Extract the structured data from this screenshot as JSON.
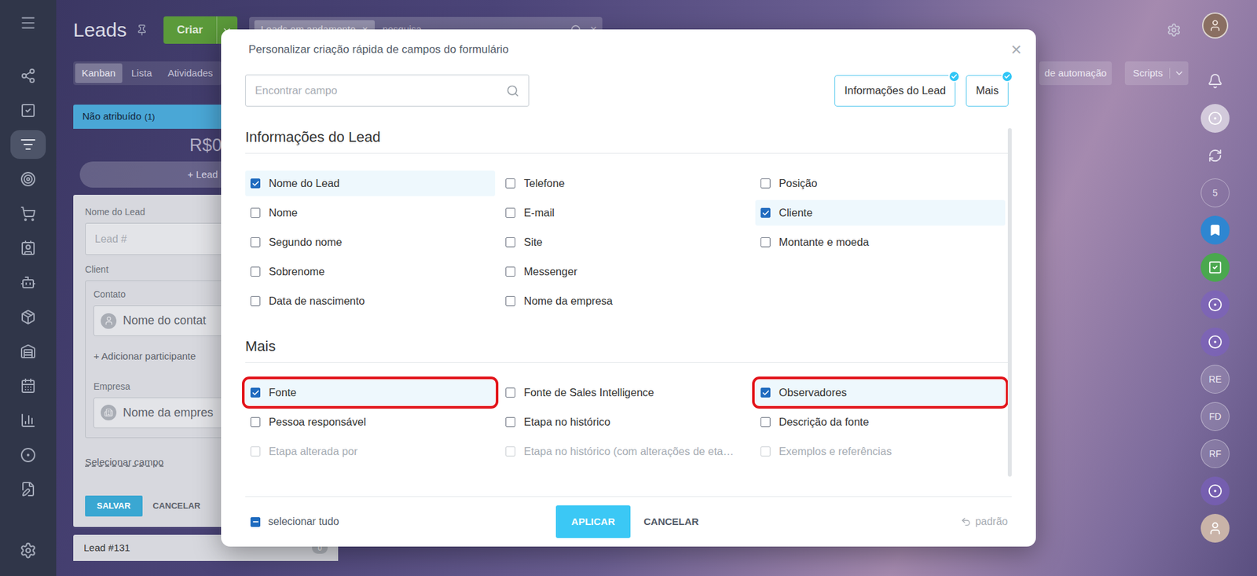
{
  "sidebar": {
    "items": [
      {
        "selected": false
      },
      {
        "selected": false
      },
      {
        "selected": true
      },
      {
        "selected": false
      },
      {
        "selected": false
      },
      {
        "selected": false
      },
      {
        "selected": false
      },
      {
        "selected": false
      },
      {
        "selected": false
      },
      {
        "selected": false
      },
      {
        "selected": false
      },
      {
        "selected": false
      },
      {
        "selected": false
      }
    ]
  },
  "header": {
    "title": "Leads",
    "create_button": "Criar",
    "filter_tag": "Leads em andamento",
    "tag_remove": "×",
    "search_placeholder": "pesquisa",
    "search_clear": "×"
  },
  "views": [
    {
      "label": "Kanban",
      "selected": true
    },
    {
      "label": "Lista",
      "selected": false
    },
    {
      "label": "Atividades",
      "selected": false
    }
  ],
  "toolbar_right": {
    "automation": "de automação",
    "scripts": "Scripts"
  },
  "rail": [
    {
      "kind": "bell",
      "label": "",
      "color": "#ffffff"
    },
    {
      "kind": "ring",
      "label": "",
      "color": "#ffffff"
    },
    {
      "kind": "sync",
      "label": "",
      "color": "#ffffff"
    },
    {
      "kind": "count",
      "label": "5",
      "color": "#ffffff"
    },
    {
      "kind": "bookmark",
      "label": "",
      "color": "#2e86d1"
    },
    {
      "kind": "app",
      "label": "",
      "color": "#4aa84e"
    },
    {
      "kind": "ring",
      "label": "",
      "color": "#7b5fc4"
    },
    {
      "kind": "ring",
      "label": "",
      "color": "#7b5fc4"
    },
    {
      "kind": "initials",
      "label": "RE",
      "color": "#ffffff"
    },
    {
      "kind": "initials",
      "label": "FD",
      "color": "#ffffff"
    },
    {
      "kind": "initials",
      "label": "RF",
      "color": "#ffffff"
    },
    {
      "kind": "ring",
      "label": "",
      "color": "#7b5fc4"
    },
    {
      "kind": "avatar",
      "label": "",
      "color": "#c9b3a8"
    }
  ],
  "column": {
    "title": "Não atribuído",
    "count": "(1)",
    "sum": "R$0",
    "quick_add": "+ Lead r",
    "form": {
      "name_label": "Nome do Lead",
      "name_placeholder": "Lead #",
      "client_label": "Client",
      "contact_label": "Contato",
      "contact_placeholder": "Nome do contat",
      "add_participant": "+ Adicionar participante",
      "company_label": "Empresa",
      "company_placeholder": "Nome da empres",
      "select_field": "Selecionar campo",
      "save": "SALVAR",
      "cancel": "CANCELAR"
    },
    "next_card": {
      "title": "Lead #131",
      "badge": "0"
    }
  },
  "modal": {
    "title": "Personalizar criação rápida de campos do formulário",
    "close": "×",
    "search": {
      "placeholder": "Encontrar campo"
    },
    "filters": [
      {
        "label": "Informações do Lead",
        "selected": true
      },
      {
        "label": "Mais",
        "selected": true
      }
    ],
    "sections": [
      {
        "title": "Informações do Lead",
        "fields": [
          {
            "label": "Nome do Lead",
            "checked": true,
            "highlighted": true,
            "disabled": false,
            "annotated": false
          },
          {
            "label": "Nome",
            "checked": false,
            "highlighted": false,
            "disabled": false,
            "annotated": false
          },
          {
            "label": "Segundo nome",
            "checked": false,
            "highlighted": false,
            "disabled": false,
            "annotated": false
          },
          {
            "label": "Sobrenome",
            "checked": false,
            "highlighted": false,
            "disabled": false,
            "annotated": false
          },
          {
            "label": "Data de nascimento",
            "checked": false,
            "highlighted": false,
            "disabled": false,
            "annotated": false
          },
          {
            "label": "Telefone",
            "checked": false,
            "highlighted": false,
            "disabled": false,
            "annotated": false
          },
          {
            "label": "E-mail",
            "checked": false,
            "highlighted": false,
            "disabled": false,
            "annotated": false
          },
          {
            "label": "Site",
            "checked": false,
            "highlighted": false,
            "disabled": false,
            "annotated": false
          },
          {
            "label": "Messenger",
            "checked": false,
            "highlighted": false,
            "disabled": false,
            "annotated": false
          },
          {
            "label": "Nome da empresa",
            "checked": false,
            "highlighted": false,
            "disabled": false,
            "annotated": false
          },
          {
            "label": "Posição",
            "checked": false,
            "highlighted": false,
            "disabled": false,
            "annotated": false
          },
          {
            "label": "Cliente",
            "checked": true,
            "highlighted": true,
            "disabled": false,
            "annotated": false
          },
          {
            "label": "Montante e moeda",
            "checked": false,
            "highlighted": false,
            "disabled": false,
            "annotated": false
          }
        ]
      },
      {
        "title": "Mais",
        "fields": [
          {
            "label": "Fonte",
            "checked": true,
            "highlighted": true,
            "disabled": false,
            "annotated": true
          },
          {
            "label": "Pessoa responsável",
            "checked": false,
            "highlighted": false,
            "disabled": false,
            "annotated": false
          },
          {
            "label": "Etapa alterada por",
            "checked": false,
            "highlighted": false,
            "disabled": true,
            "annotated": false
          },
          {
            "label": "Fonte de Sales Intelligence",
            "checked": false,
            "highlighted": false,
            "disabled": false,
            "annotated": false
          },
          {
            "label": "Etapa no histórico",
            "checked": false,
            "highlighted": false,
            "disabled": false,
            "annotated": false
          },
          {
            "label": "Etapa no histórico (com alterações de eta…",
            "checked": false,
            "highlighted": false,
            "disabled": true,
            "annotated": false
          },
          {
            "label": "Observadores",
            "checked": true,
            "highlighted": true,
            "disabled": false,
            "annotated": true
          },
          {
            "label": "Descrição da fonte",
            "checked": false,
            "highlighted": false,
            "disabled": false,
            "annotated": false
          },
          {
            "label": "Exemplos e referências",
            "checked": false,
            "highlighted": false,
            "disabled": true,
            "annotated": false
          }
        ]
      }
    ],
    "footer": {
      "select_all": {
        "label": "selecionar tudo",
        "partial": true
      },
      "apply": "APLICAR",
      "cancel": "CANCELAR",
      "reset": "padrão"
    }
  }
}
